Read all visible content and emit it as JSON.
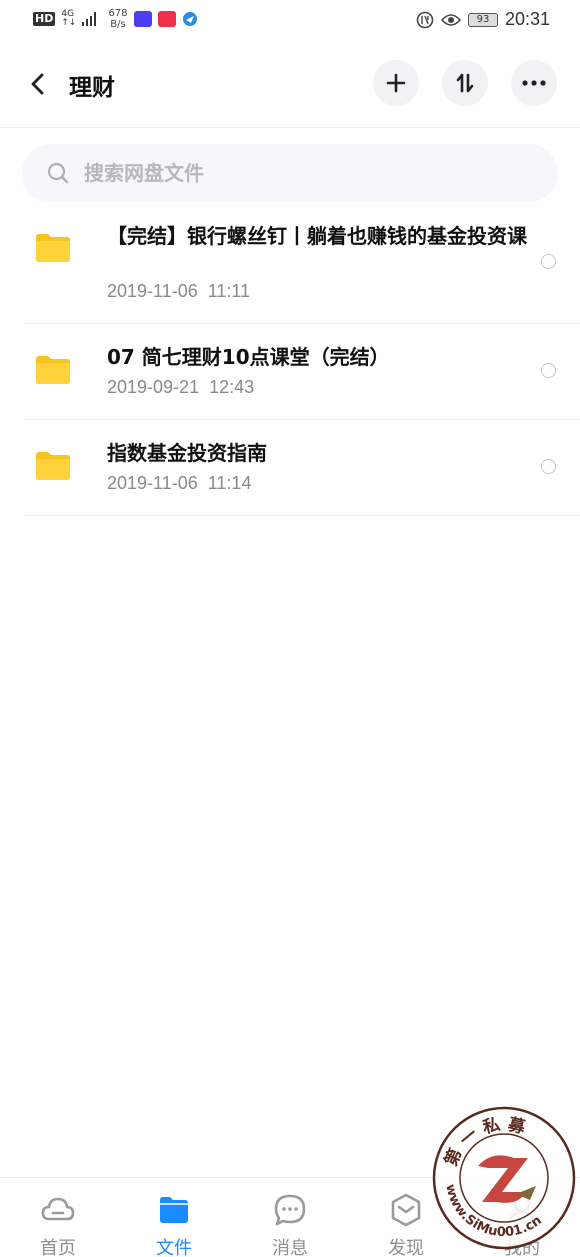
{
  "status_bar": {
    "hd": "HD",
    "net_top": "4G",
    "net_bottom": "↑↓",
    "speed_value": "678",
    "speed_unit": "B/s",
    "battery": "93",
    "time": "20:31"
  },
  "header": {
    "title": "理财"
  },
  "search": {
    "placeholder": "搜索网盘文件"
  },
  "files": [
    {
      "name": "【完结】银行螺丝钉丨躺着也赚钱的基金投资课",
      "date": "2019-11-06  11:11"
    },
    {
      "name": "07 简七理财10点课堂（完结）",
      "date": "2019-09-21  12:43"
    },
    {
      "name": "指数基金投资指南",
      "date": "2019-11-06  11:14"
    }
  ],
  "bottom_nav": [
    {
      "label": "首页",
      "icon": "cloud-icon"
    },
    {
      "label": "文件",
      "icon": "folder-icon",
      "active": true
    },
    {
      "label": "消息",
      "icon": "chat-bubble-icon"
    },
    {
      "label": "发现",
      "icon": "discover-cube-icon"
    },
    {
      "label": "我的",
      "icon": "user-icon"
    }
  ],
  "watermark": {
    "top_text": "第 一 私 募",
    "bottom_text": "www.SiMu001.cn"
  },
  "colors": {
    "accent": "#1a8cff",
    "folder": "#fdd23a",
    "folder_tab": "#f7c31c",
    "muted": "#8a8a8e"
  }
}
